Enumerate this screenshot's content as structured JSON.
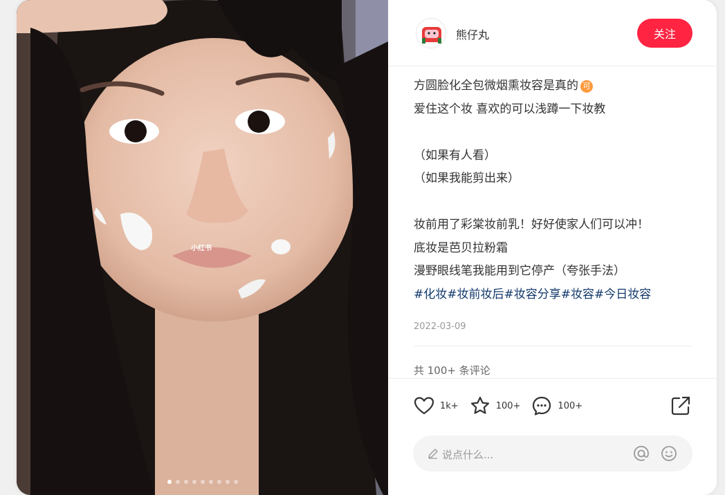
{
  "author": {
    "name": "熊仔丸"
  },
  "follow_button": "关注",
  "post": {
    "line1": "方圆脸化全包微烟熏妆容是真的",
    "line1_emoji": "可",
    "line2": "爱住这个妆 喜欢的可以浅蹲一下妆教",
    "line3": "（如果有人看）",
    "line4": "（如果我能剪出来）",
    "line5": "妆前用了彩棠妆前乳！好好使家人们可以冲！",
    "line6": "底妆是芭贝拉粉霜",
    "line7": "漫野眼线笔我能用到它停产（夸张手法）",
    "tags": "#化妆#妆前妆后#妆容分享#妆容#今日妆容",
    "date": "2022-03-09"
  },
  "comments_count": "共 100+ 条评论",
  "engagement": {
    "likes": "1k+",
    "collects": "100+",
    "comments": "100+"
  },
  "comment_input": {
    "placeholder": "说点什么..."
  },
  "photo": {
    "watermark": "小红书",
    "slide_count": 9,
    "active_slide": 1
  },
  "colors": {
    "accent": "#ff2442",
    "tag": "#13386c",
    "text": "#333333"
  },
  "icons": [
    "heart-icon",
    "star-icon",
    "comment-icon",
    "share-icon",
    "pencil-icon",
    "at-icon",
    "emoji-icon"
  ]
}
